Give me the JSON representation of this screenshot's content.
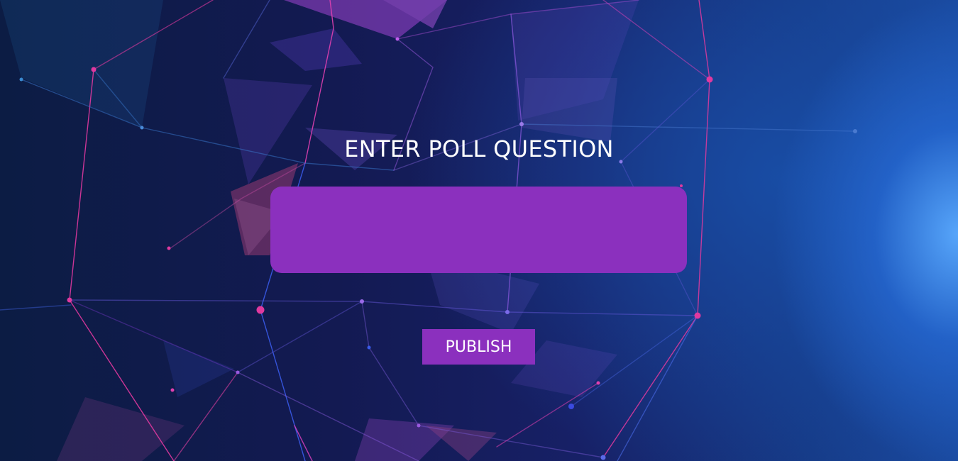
{
  "poll": {
    "heading": "ENTER POLL QUESTION",
    "question_value": "",
    "question_placeholder": "",
    "publish_label": "PUBLISH"
  },
  "colors": {
    "accent_purple": "#8b30be",
    "text": "#ffffff",
    "network_pink": "#e0399f",
    "network_violet": "#9a4ee0",
    "network_blue": "#3a6fd8"
  },
  "background": {
    "image": "abstract-polygon-network-background"
  }
}
